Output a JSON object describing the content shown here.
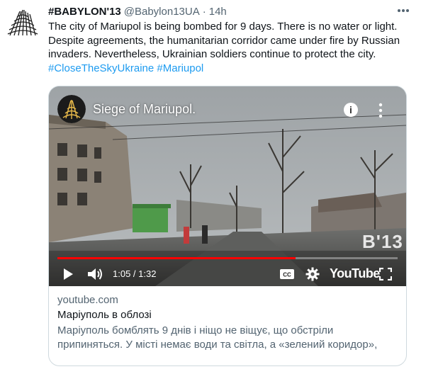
{
  "tweet": {
    "author_name": "#BABYLON'13",
    "handle": "@Babylon13UA",
    "separator": "·",
    "time": "14h",
    "text": "The city of Mariupol is being bombed for 9 days. There is no water or light. Despite agreements, the humanitarian corridor came under fire by Russian invaders. Nevertheless, Ukrainian soldiers continue to protect the city.",
    "hashtags": "#CloseTheSkyUkraine #Mariupol"
  },
  "video": {
    "title": "Siege of Mariupol.",
    "watermark": "B'13",
    "progress": 0.7,
    "time_display": "1:05 / 1:32",
    "logo_text": "YouTube"
  },
  "card": {
    "domain": "youtube.com",
    "title": "Маріуполь в облозі",
    "description": "Маріуполь бомблять 9 днів і ніщо не віщує, що обстріли припиняться. У місті немає води та світла, а «зелений коридор», пр..."
  },
  "colors": {
    "link": "#1d9bf0",
    "secondary_text": "#536471",
    "progress": "#ff0000",
    "border": "#cfd9de"
  },
  "icons": {
    "more": "ellipsis-icon",
    "play": "play-icon",
    "volume": "volume-icon",
    "captions": "captions-icon",
    "settings": "gear-icon",
    "fullscreen": "fullscreen-icon",
    "info": "info-icon",
    "share": "share-icon"
  }
}
